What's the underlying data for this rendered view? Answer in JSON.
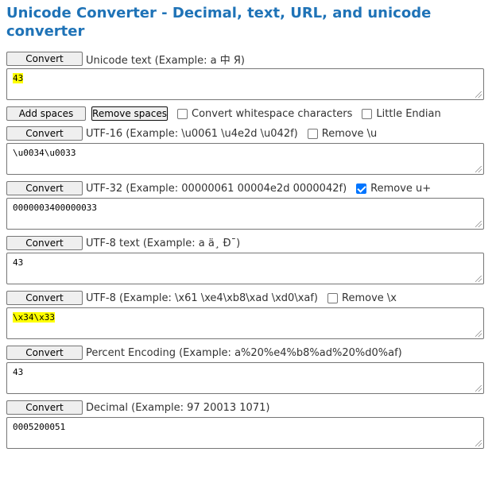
{
  "title": "Unicode Converter - Decimal, text, URL, and unicode converter",
  "convert_label": "Convert",
  "unicode": {
    "label": "Unicode text (Example: a 中 Я)",
    "value": "43"
  },
  "spaces_row": {
    "add_label": "Add spaces",
    "remove_label": "Remove spaces",
    "whitespace_label": "Convert whitespace characters",
    "endian_label": "Little Endian"
  },
  "utf16": {
    "label": "UTF-16 (Example: \\u0061 \\u4e2d \\u042f)",
    "option": "Remove \\u",
    "value": "\\u0034\\u0033"
  },
  "utf32": {
    "label": "UTF-32 (Example: 00000061 00004e2d 0000042f)",
    "option": "Remove u+",
    "value": "0000003400000033"
  },
  "utf8text": {
    "label": "UTF-8 text (Example: a ä¸ Ð¯)",
    "value": "43"
  },
  "utf8": {
    "label": "UTF-8 (Example: \\x61 \\xe4\\xb8\\xad \\xd0\\xaf)",
    "option": "Remove \\x",
    "value": "\\x34\\x33"
  },
  "percent": {
    "label": "Percent Encoding (Example: a%20%e4%b8%ad%20%d0%af)",
    "value": "43"
  },
  "decimal": {
    "label": "Decimal (Example: 97 20013 1071)",
    "value": "0005200051"
  },
  "colors": {
    "title": "#1f73b7",
    "highlight": "#ffff00",
    "checkbox_checked": "#0075ff"
  }
}
